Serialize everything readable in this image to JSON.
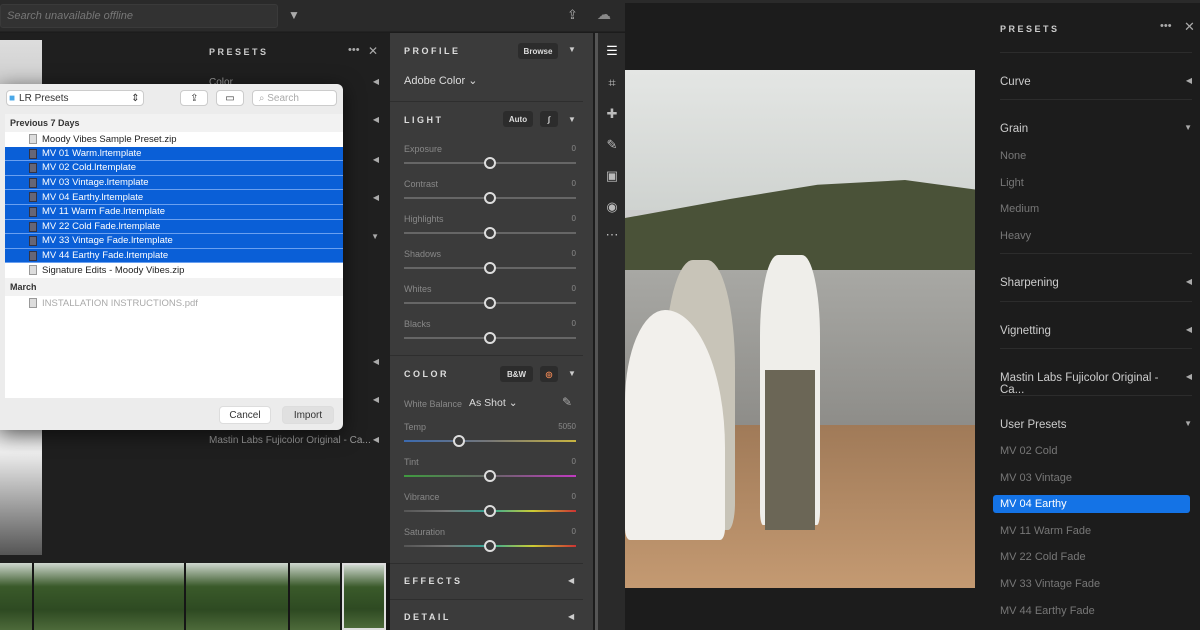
{
  "topbar": {
    "search_placeholder": "Search unavailable offline",
    "filter_icon": "filter-icon",
    "share_icon": "share-icon",
    "cloud_icon": "cloud-offline-icon"
  },
  "left_presets": {
    "title": "PRESETS",
    "items": [
      "Color"
    ],
    "last_item": "Mastin Labs Fujicolor Original - Ca..."
  },
  "dialog": {
    "location": "LR Presets",
    "search_placeholder": "Search",
    "groups": [
      {
        "label": "Previous 7 Days",
        "files": [
          {
            "name": "Moody Vibes Sample Preset.zip",
            "selected": false
          },
          {
            "name": "MV 01 Warm.lrtemplate",
            "selected": true
          },
          {
            "name": "MV 02 Cold.lrtemplate",
            "selected": true
          },
          {
            "name": "MV 03 Vintage.lrtemplate",
            "selected": true
          },
          {
            "name": "MV 04 Earthy.lrtemplate",
            "selected": true
          },
          {
            "name": "MV 11 Warm Fade.lrtemplate",
            "selected": true
          },
          {
            "name": "MV 22 Cold Fade.lrtemplate",
            "selected": true
          },
          {
            "name": "MV 33 Vintage Fade.lrtemplate",
            "selected": true
          },
          {
            "name": "MV 44 Earthy Fade.lrtemplate",
            "selected": true
          },
          {
            "name": "Signature Edits - Moody Vibes.zip",
            "selected": false
          }
        ]
      },
      {
        "label": "March",
        "files": [
          {
            "name": "INSTALLATION INSTRUCTIONS.pdf",
            "selected": false,
            "disabled": true
          }
        ]
      }
    ],
    "cancel": "Cancel",
    "import": "Import"
  },
  "edit": {
    "profile": {
      "title": "PROFILE",
      "browse": "Browse",
      "value": "Adobe Color"
    },
    "light": {
      "title": "LIGHT",
      "auto": "Auto",
      "sliders": [
        {
          "label": "Exposure",
          "value": "0",
          "pos": 0.5
        },
        {
          "label": "Contrast",
          "value": "0",
          "pos": 0.5
        },
        {
          "label": "Highlights",
          "value": "0",
          "pos": 0.5
        },
        {
          "label": "Shadows",
          "value": "0",
          "pos": 0.5
        },
        {
          "label": "Whites",
          "value": "0",
          "pos": 0.5
        },
        {
          "label": "Blacks",
          "value": "0",
          "pos": 0.5
        }
      ]
    },
    "color": {
      "title": "COLOR",
      "bw": "B&W",
      "wb_label": "White Balance",
      "wb_value": "As Shot",
      "sliders": [
        {
          "label": "Temp",
          "value": "5050",
          "pos": 0.32
        },
        {
          "label": "Tint",
          "value": "0",
          "pos": 0.5
        },
        {
          "label": "Vibrance",
          "value": "0",
          "pos": 0.5
        },
        {
          "label": "Saturation",
          "value": "0",
          "pos": 0.5
        }
      ]
    },
    "effects": "EFFECTS",
    "detail": "DETAIL"
  },
  "right_presets": {
    "title": "PRESETS",
    "sections": [
      "Curve",
      "Grain",
      "Sharpening",
      "Vignetting",
      "Mastin Labs Fujicolor Original - Ca...",
      "User Presets"
    ],
    "grain_items": [
      "None",
      "Light",
      "Medium",
      "Heavy"
    ],
    "user_presets": [
      "MV 02 Cold",
      "MV 03 Vintage",
      "MV 04 Earthy",
      "MV 11 Warm Fade",
      "MV 22 Cold Fade",
      "MV 33 Vintage Fade",
      "MV 44 Earthy Fade"
    ],
    "selected": "MV 04 Earthy",
    "accent": "#1473e6"
  }
}
